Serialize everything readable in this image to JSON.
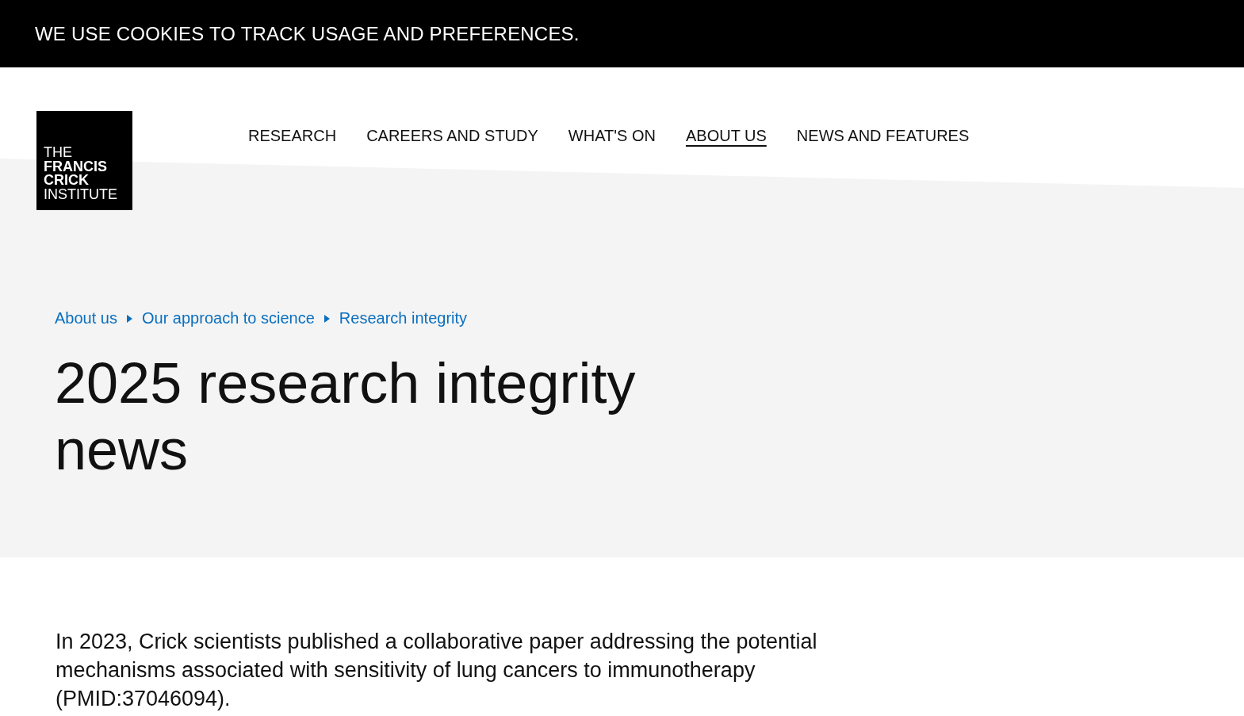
{
  "cookie_banner": {
    "text": "WE USE COOKIES TO TRACK USAGE AND PREFERENCES."
  },
  "logo": {
    "lines": [
      {
        "text": "THE",
        "bold": false
      },
      {
        "text": "FRANCIS",
        "bold": true
      },
      {
        "text": "CRICK",
        "bold": true
      },
      {
        "text": "INSTITUTE",
        "bold": false
      }
    ]
  },
  "nav": [
    {
      "label": "RESEARCH",
      "selected": false
    },
    {
      "label": "CAREERS AND STUDY",
      "selected": false
    },
    {
      "label": "WHAT'S ON",
      "selected": false
    },
    {
      "label": "ABOUT US",
      "selected": true
    },
    {
      "label": "NEWS AND FEATURES",
      "selected": false
    }
  ],
  "breadcrumb": [
    "About us",
    "Our approach to science",
    "Research integrity"
  ],
  "title": "2025 research integrity news",
  "body": "In 2023, Crick scientists published a collaborative paper addressing the potential mechanisms associated with sensitivity of lung cancers to immunotherapy (PMID:37046094)."
}
